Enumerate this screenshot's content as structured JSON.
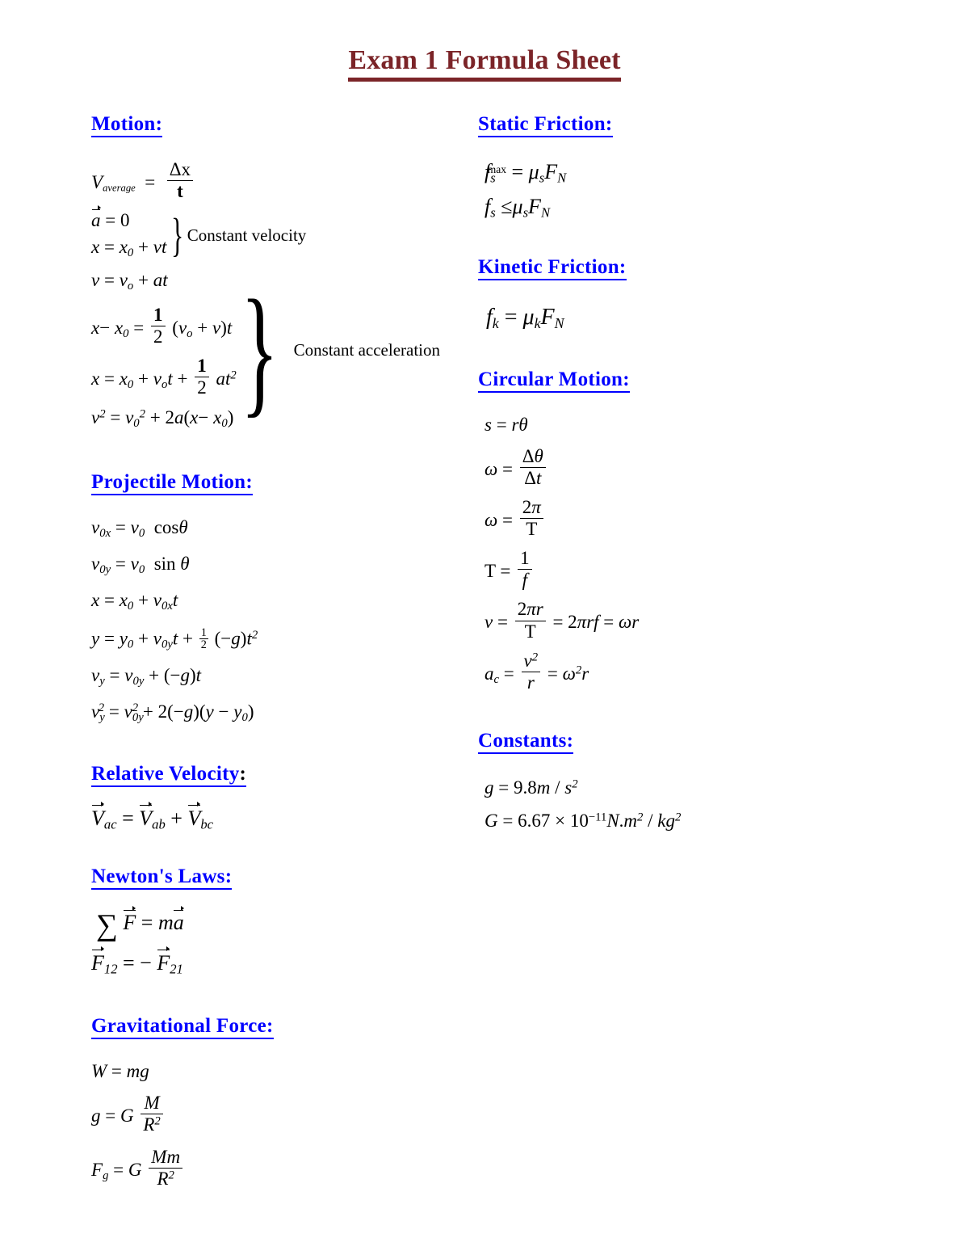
{
  "document": {
    "title": "Exam 1 Formula Sheet",
    "title_color": "#7B2428",
    "header_color": "#0000FF",
    "body_color": "#000000",
    "background": "#ffffff"
  },
  "left_column": {
    "sections": [
      {
        "id": "motion",
        "heading": "Motion:",
        "formulas": [
          "V_average = Δx / t",
          "a⃗ = 0",
          "x = x₀ + vt",
          "v = v₀ + at",
          "x − x₀ = ½(v₀ + v)t",
          "x = x₀ + v₀t + ½at²",
          "v² = v₀² + 2a(x − x₀)"
        ],
        "group_labels": [
          "Constant velocity",
          "Constant acceleration"
        ]
      },
      {
        "id": "projectile-motion",
        "heading": "Projectile Motion:",
        "formulas": [
          "v₀ₓ = v₀ cosθ",
          "v₀ᵧ = v₀ sin θ",
          "x = x₀ + v₀ₓt",
          "y = y₀ + v₀ᵧt + ½(−g)t²",
          "vᵧ = v₀ᵧ + (−g)t",
          "vᵧ² = v₀ᵧ² + 2(−g)(y − y₀)"
        ]
      },
      {
        "id": "relative-velocity",
        "heading": "Relative Velocity",
        "heading_suffix": ":",
        "formulas": [
          "V⃗ac = V⃗ab + V⃗bc"
        ]
      },
      {
        "id": "newtons-laws",
        "heading": "Newton's Laws:",
        "formulas": [
          "ΣF⃗ = ma⃗",
          "F⃗12 = −F⃗21"
        ]
      },
      {
        "id": "gravitational-force",
        "heading": "Gravitational Force:",
        "formulas": [
          "W = mg",
          "g = G M / R²",
          "Fg = G Mm / R²"
        ]
      }
    ]
  },
  "right_column": {
    "sections": [
      {
        "id": "static-friction",
        "heading": "Static Friction:",
        "formulas": [
          "fs^max = μs FN",
          "fs ≤ μs FN"
        ]
      },
      {
        "id": "kinetic-friction",
        "heading": "Kinetic Friction:",
        "formulas": [
          "fk = μk FN"
        ]
      },
      {
        "id": "circular-motion",
        "heading": "Circular Motion:",
        "formulas": [
          "s = rθ",
          "ω = Δθ / Δt",
          "ω = 2π / T",
          "T = 1 / f",
          "v = 2πr / T = 2πrf = ωr",
          "a_c = v² / r = ω²r"
        ]
      },
      {
        "id": "constants",
        "heading": "Constants:",
        "formulas": [
          "g = 9.8 m/s²",
          "G = 6.67 × 10⁻¹¹ N.m² / kg²"
        ],
        "values": {
          "g": "9.8",
          "g_units": "m/s²",
          "G_mantissa": "6.67",
          "G_exponent": "-11",
          "G_units": "N.m²/kg²"
        }
      }
    ]
  },
  "symbols": {
    "delta": "Δ",
    "theta": "θ",
    "omega": "ω",
    "mu": "μ",
    "pi": "π",
    "sigma_sum": "∑",
    "leq": "≤",
    "times": "×",
    "minus": "−",
    "vector_arrow": "→"
  },
  "labels": {
    "constant_velocity": "Constant velocity",
    "constant_acceleration": "Constant acceleration",
    "max_superscript": "max",
    "cos": "cos",
    "sin": "sin"
  }
}
